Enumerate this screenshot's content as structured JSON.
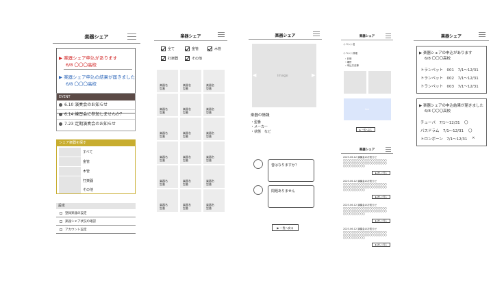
{
  "app_title": "楽器シェア",
  "screen1": {
    "notices": [
      {
        "title": "▶ 楽器シェア申込があります",
        "sub": "6/8 〇〇〇高校"
      },
      {
        "title": "▶ 楽器シェア申込の結果が届きました",
        "sub": "6/8 〇〇〇高校"
      }
    ],
    "event_header": "EVENT",
    "events": [
      "6.10 演奏会のお知らせ",
      "6.14 練習会に参加しませんか？",
      "7.23 定期演奏会のお知らせ"
    ],
    "share_header": "シェア楽器を探す",
    "share_items": [
      "すべて",
      "金管",
      "木管",
      "打楽器",
      "その他"
    ],
    "settings_header": "設定",
    "settings_items": [
      "登録楽器の設定",
      "楽器シェア状況の確認",
      "アカウント設定"
    ]
  },
  "screen2": {
    "filters": [
      "全て",
      "金管",
      "木管",
      "打楽器",
      "その他"
    ],
    "cell_label": "楽器名\n型番"
  },
  "screen3": {
    "image_label": "image",
    "info_title": "楽器の情報",
    "info_lines": [
      "・型番",
      "・メーカー",
      "・状態　など"
    ],
    "msg1": "音はなりますか？",
    "msg2": "問題ありません",
    "back_button": "▶ 一覧へ戻る"
  },
  "screen4": {
    "event_name": "イベント名",
    "event_detail_title": "イベント詳細",
    "event_details": [
      "・日時",
      "・場所",
      "・申込方法等"
    ],
    "link_label": "link",
    "back_button": "▶ 一覧へ戻る",
    "notices": [
      {
        "date": "2023.06.12 演奏会のお知らせ",
        "body": "〇〇〇〇〇〇〇〇〇〇〇〇〇〇〇〇〇〇〇〇\n〇〇〇〇〇〇〇〇〇〇〇〇〇〇〇〇〇〇〇〇\n〇〇〇〇〇〇〇〇〇〇"
      },
      {
        "date": "2023.06.12 演奏会のお知らせ",
        "body": "〇〇〇〇〇〇〇〇〇〇〇〇〇〇〇〇〇〇〇〇\n〇〇〇〇〇〇〇〇〇〇〇〇〇〇〇〇〇〇〇〇\n〇〇〇〇〇〇〇〇〇〇"
      },
      {
        "date": "2023.06.12 演奏会のお知らせ",
        "body": "〇〇〇〇〇〇〇〇〇〇〇〇〇〇〇〇〇〇〇〇\n〇〇〇〇〇〇〇〇〇〇〇〇〇〇〇〇〇〇〇〇\n〇〇〇〇〇〇〇〇〇〇"
      },
      {
        "date": "2023.06.12 演奏会のお知らせ",
        "body": "〇〇〇〇〇〇〇〇〇〇〇〇〇〇〇〇〇〇〇〇\n〇〇〇〇〇〇〇〇〇〇〇〇〇〇〇〇〇〇〇〇\n〇〇〇〇〇〇〇〇〇〇"
      }
    ],
    "detail_button": "▶ 詳しく見る"
  },
  "screen5": {
    "box1_title": "▶ 楽器シェアの申込があります",
    "box1_sub": "6/8 〇〇〇高校",
    "box1_rows": [
      "トランペット　001　7/1〜12/31",
      "トランペット　002　7/1〜12/31",
      "トランペット　003　7/1〜12/31"
    ],
    "box2_title": "▶ 楽器シェアの申込結果が届きました",
    "box2_sub": "6/8 〇〇〇高校",
    "box2_rows": [
      {
        "text": "チューバ　7/1〜12/31",
        "mark": "〇"
      },
      {
        "text": "バスドラム　7/1〜12/31",
        "mark": "〇"
      },
      {
        "text": "トロンボーン　7/1〜12/31",
        "mark": "×"
      }
    ]
  }
}
